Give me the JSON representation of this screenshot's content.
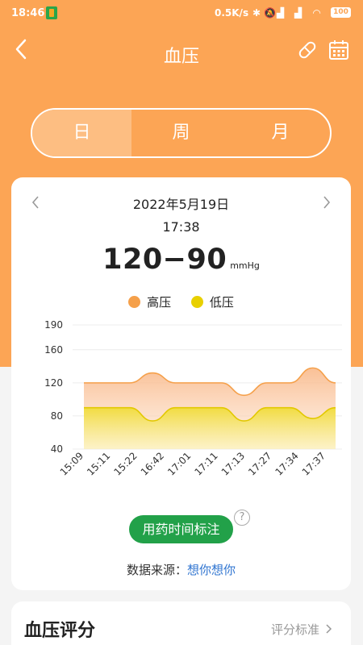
{
  "status_bar": {
    "time": "18:46",
    "network_speed": "0.5K/s",
    "battery": "100"
  },
  "header": {
    "title": "血压",
    "back_icon": "chevron-left-icon",
    "pill_icon": "pill-icon",
    "calendar_icon": "calendar-icon"
  },
  "tabs": [
    {
      "label": "日",
      "active": true
    },
    {
      "label": "周",
      "active": false
    },
    {
      "label": "月",
      "active": false
    }
  ],
  "card": {
    "date": "2022年5月19日",
    "time": "17:38",
    "reading": "120−90",
    "unit": "mmHg",
    "legend": {
      "high": "高压",
      "low": "低压"
    },
    "mark_button": "用药时间标注",
    "help": "?",
    "source_label": "数据来源：",
    "source_value": "想你想你"
  },
  "score": {
    "title": "血压评分",
    "standard": "评分标准"
  },
  "colors": {
    "orange": "#fca555",
    "high_series": "#f5a04a",
    "low_series": "#e8d000",
    "green_button": "#22a149",
    "link": "#2f74d0"
  },
  "chart_data": {
    "type": "area",
    "x": [
      "15:09",
      "15:11",
      "15:22",
      "16:42",
      "17:01",
      "17:11",
      "17:13",
      "17:27",
      "17:34",
      "17:37"
    ],
    "y_ticks": [
      40,
      80,
      120,
      160,
      190
    ],
    "ylim": [
      40,
      190
    ],
    "series": [
      {
        "name": "高压",
        "values": [
          120,
          120,
          120,
          132,
          120,
          120,
          120,
          105,
          120,
          120,
          138,
          120
        ]
      },
      {
        "name": "低压",
        "values": [
          90,
          90,
          90,
          74,
          90,
          90,
          90,
          74,
          90,
          90,
          77,
          90
        ]
      }
    ],
    "grid": true,
    "legend_position": "top-center"
  }
}
